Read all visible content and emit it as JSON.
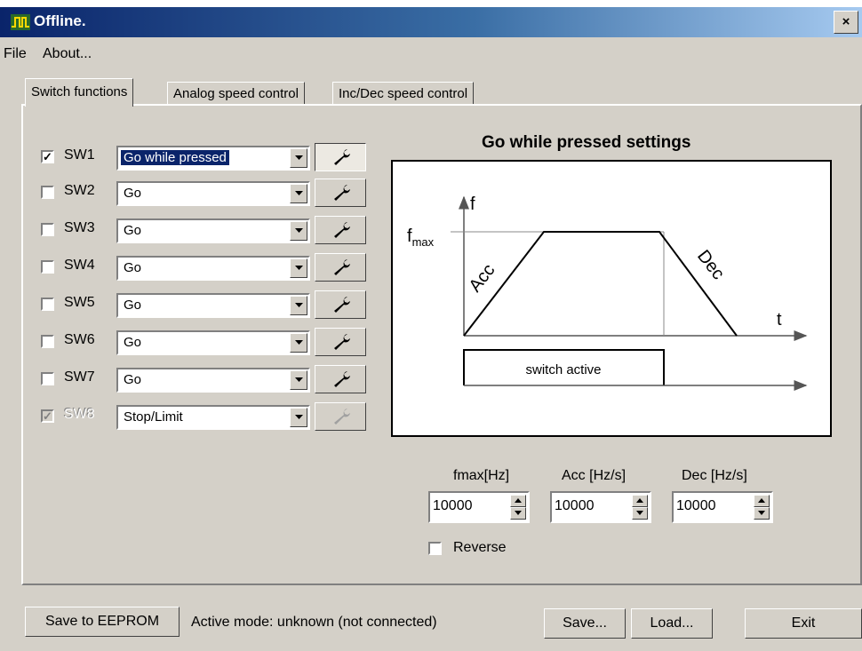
{
  "window": {
    "title": "Offline.",
    "close": "×"
  },
  "menu": {
    "items": [
      "File",
      "About..."
    ]
  },
  "tabs": [
    "Switch functions",
    "Analog speed control",
    "Inc/Dec speed control"
  ],
  "switches": [
    {
      "label": "SW1",
      "checked": true,
      "value": "Go while pressed",
      "enabled": true
    },
    {
      "label": "SW2",
      "checked": false,
      "value": "Go",
      "enabled": true
    },
    {
      "label": "SW3",
      "checked": false,
      "value": "Go",
      "enabled": true
    },
    {
      "label": "SW4",
      "checked": false,
      "value": "Go",
      "enabled": true
    },
    {
      "label": "SW5",
      "checked": false,
      "value": "Go",
      "enabled": true
    },
    {
      "label": "SW6",
      "checked": false,
      "value": "Go",
      "enabled": true
    },
    {
      "label": "SW7",
      "checked": false,
      "value": "Go",
      "enabled": true
    },
    {
      "label": "SW8",
      "checked": true,
      "value": "Stop/Limit",
      "enabled": false
    }
  ],
  "diagram": {
    "title": "Go while pressed settings",
    "y_axis": "f",
    "fmax_main": "f",
    "fmax_sub": "max",
    "acc": "Acc",
    "dec": "Dec",
    "x_axis": "t",
    "switch_label": "switch active"
  },
  "params": {
    "fmax": {
      "label": "fmax[Hz]",
      "value": "10000"
    },
    "acc": {
      "label": "Acc [Hz/s]",
      "value": "10000"
    },
    "dec": {
      "label": "Dec [Hz/s]",
      "value": "10000"
    }
  },
  "reverse": {
    "label": "Reverse",
    "checked": false
  },
  "footer": {
    "save_eeprom": "Save to EEPROM",
    "status": "Active mode: unknown (not connected)",
    "save": "Save...",
    "load": "Load...",
    "exit": "Exit"
  },
  "colors": {
    "title_start": "#0a246a",
    "title_end": "#a6caf0",
    "face": "#d4d0c8",
    "selection": "#0a246a"
  },
  "icons": {
    "app": "pulse-icon",
    "tool": "wrench-icon",
    "combo": "chevron-down-icon"
  }
}
